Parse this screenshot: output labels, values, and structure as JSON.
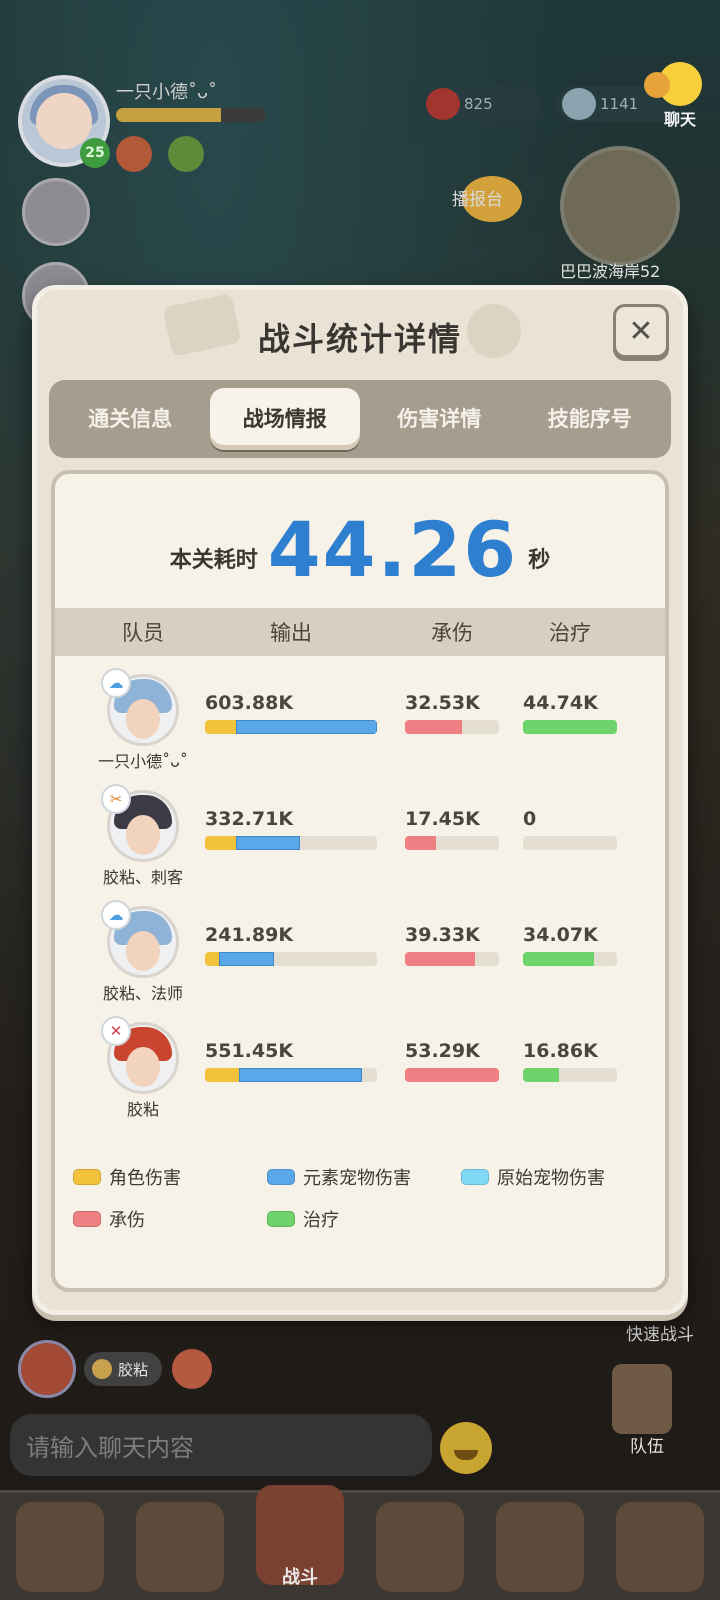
{
  "hud": {
    "player_name": "一只小德˚ᴗ˚",
    "level": "25",
    "star_count": "825",
    "gem_count": "1141",
    "chat_label": "聊天",
    "broadcast_label": "播报台",
    "map_label": "巴巴波海岸52",
    "quick_battle_label": "快速战斗",
    "team_label": "队伍",
    "leader_chip": "胶粘",
    "chat_placeholder": "请输入聊天内容",
    "nav_center_label": "战斗"
  },
  "modal": {
    "title": "战斗统计详情",
    "close_glyph": "✕",
    "tabs": [
      {
        "label": "通关信息"
      },
      {
        "label": "战场情报"
      },
      {
        "label": "伤害详情"
      },
      {
        "label": "技能序号"
      }
    ],
    "active_tab": 1,
    "time_label": "本关耗时",
    "time_value": "44.26",
    "time_unit": "秒",
    "columns": [
      "队员",
      "输出",
      "承伤",
      "治疗"
    ],
    "members": [
      {
        "name": "一只小德˚ᴗ˚",
        "class_icon": "swirl-icon",
        "output": "603.88K",
        "output_role_frac": 0.18,
        "output_pet_frac": 0.82,
        "taken": "32.53K",
        "taken_frac": 0.61,
        "heal": "44.74K",
        "heal_frac": 1.0
      },
      {
        "name": "胶粘、刺客",
        "class_icon": "crossed-blades-icon",
        "output": "332.71K",
        "output_role_frac": 0.18,
        "output_pet_frac": 0.37,
        "taken": "17.45K",
        "taken_frac": 0.33,
        "heal": "0",
        "heal_frac": 0
      },
      {
        "name": "胶粘、法师",
        "class_icon": "swirl-icon",
        "output": "241.89K",
        "output_role_frac": 0.08,
        "output_pet_frac": 0.32,
        "taken": "39.33K",
        "taken_frac": 0.74,
        "heal": "34.07K",
        "heal_frac": 0.76
      },
      {
        "name": "胶粘",
        "class_icon": "crossed-swords-icon",
        "output": "551.45K",
        "output_role_frac": 0.2,
        "output_pet_frac": 0.71,
        "taken": "53.29K",
        "taken_frac": 1.0,
        "heal": "16.86K",
        "heal_frac": 0.38
      }
    ],
    "legend": [
      {
        "label": "角色伤害",
        "color": "#f2c23c"
      },
      {
        "label": "元素宠物伤害",
        "color": "#5aa8ea"
      },
      {
        "label": "原始宠物伤害",
        "color": "#7fd8f6"
      },
      {
        "label": "承伤",
        "color": "#f07f84"
      },
      {
        "label": "治疗",
        "color": "#6fd36b"
      }
    ]
  }
}
